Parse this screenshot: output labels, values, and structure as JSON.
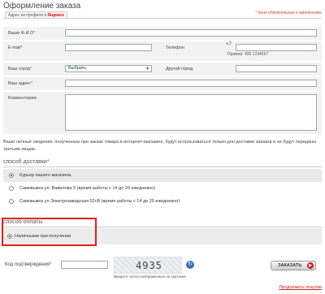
{
  "header": {
    "title": "Оформление заказа",
    "yandex_tab_prefix": "Адрес из профиля в",
    "yandex_tab_brand": "Яндексе",
    "required_note": "* поля обязательные к заполнению"
  },
  "form": {
    "fio_label": "Ваши Ф.И.О",
    "email_label": "E-mail",
    "phone_label": "Телефон",
    "phone_prefix": "+7",
    "phone_hint": "Пример: 495 1234567",
    "city_label": "Ваш город",
    "city_select_value": "Выбрать",
    "other_city_label": "Другой город",
    "address_label": "Ваш адрес",
    "comments_label": "Комментарии",
    "required_marker": "*"
  },
  "privacy_text": "Ваши личные сведения, полученные при заказе товара в интернет-магазине, будут использоваться только для доставки заказов и не будут переданы третьим лицам.",
  "delivery": {
    "title": "способ доставки",
    "required_marker": "*",
    "options": [
      {
        "label": "Курьер нашего магазина.",
        "selected": true
      },
      {
        "label": "Самовывоз ул. Вавилова 5 (время работы с 14 до 20 ежедневно)",
        "selected": false
      },
      {
        "label": "Самовывоз ул.Электрозаводская 52сВ (время работы с 14 до 20 ежедневно)",
        "selected": false
      }
    ]
  },
  "payment": {
    "title": "способ оплаты",
    "options": [
      {
        "label": "Наличными при получении",
        "selected": true
      }
    ],
    "highlight_color": "#e02020"
  },
  "confirmation": {
    "code_label": "Код подтверждения",
    "required_marker": "*",
    "captcha_digits": "4935",
    "captcha_hint": "Введите числа изображенные на картинке",
    "order_button": "ЗАКАЗАТЬ",
    "continue_link": "Продолжить покупки"
  },
  "colors": {
    "accent_red": "#cc2222",
    "form_bg": "#f2f2f2"
  }
}
